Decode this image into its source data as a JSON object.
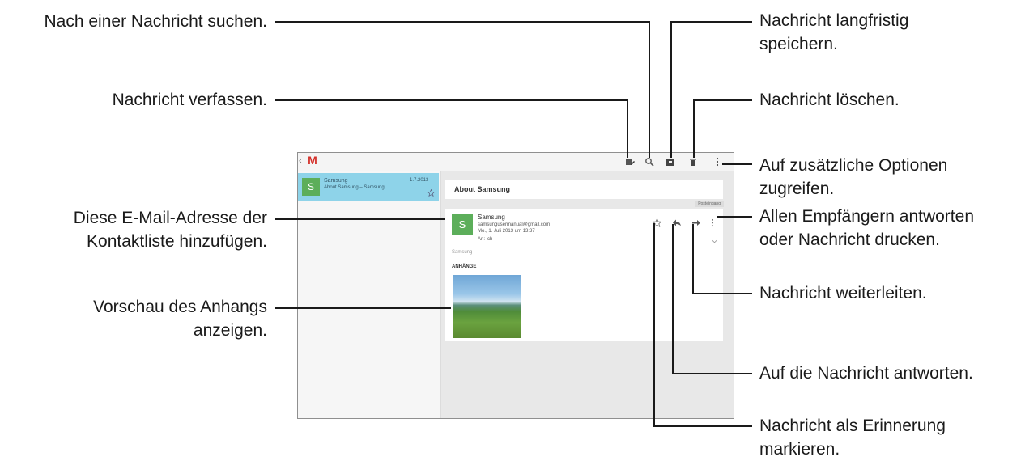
{
  "callouts": {
    "search": "Nach einer Nachricht suchen.",
    "compose": "Nachricht verfassen.",
    "add_contact_line1": "Diese E-Mail-Adresse der",
    "add_contact_line2": "Kontaktliste hinzufügen.",
    "preview_line1": "Vorschau des Anhangs",
    "preview_line2": "anzeigen.",
    "archive_line1": "Nachricht langfristig",
    "archive_line2": "speichern.",
    "delete": "Nachricht löschen.",
    "more_line1": "Auf zusätzliche Optionen",
    "more_line2": "zugreifen.",
    "reply_all_line1": "Allen Empfängern antworten",
    "reply_all_line2": "oder Nachricht drucken.",
    "forward": "Nachricht weiterleiten.",
    "reply": "Auf die Nachricht antworten.",
    "star_line1": "Nachricht als Erinnerung",
    "star_line2": "markieren."
  },
  "app": {
    "logo": "M",
    "back_caret": "‹"
  },
  "conversation_list": [
    {
      "avatar_letter": "S",
      "sender": "Samsung",
      "snippet": "About Samsung – Samsung",
      "date": "1.7.2013"
    }
  ],
  "message": {
    "subject": "About Samsung",
    "label": "Posteingang",
    "avatar_letter": "S",
    "sender_name": "Samsung",
    "sender_email": "samsungusermanual@gmail.com",
    "date": "Mo., 1. Juli 2013 um 13:37",
    "to": "An: ich",
    "body_preview": "Samsung",
    "attachments_title": "ANHÄNGE"
  },
  "icons": {
    "compose": "compose-icon",
    "search": "search-icon",
    "archive": "archive-icon",
    "delete": "trash-icon",
    "more": "overflow-icon",
    "star": "star-icon",
    "reply": "reply-icon",
    "forward": "forward-icon",
    "message_more": "overflow-icon",
    "expand": "chevron-down-icon"
  }
}
